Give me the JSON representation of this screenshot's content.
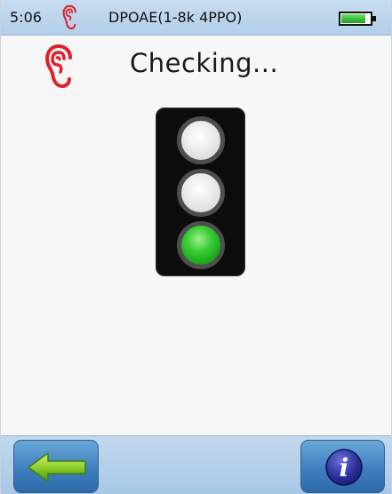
{
  "status_bar": {
    "time": "5:06",
    "ear_icon": "ear-icon",
    "protocol": "DPOAE(1-8k 4PPO)",
    "battery_level": 0.85,
    "battery_color": "#1aa31a"
  },
  "header": {
    "ear_icon": "ear-icon",
    "ear_color": "#e0202a",
    "title": "Checking..."
  },
  "traffic_light": {
    "lamps": [
      "off",
      "off",
      "on"
    ],
    "active_color": "#3fcf3b"
  },
  "bottom_bar": {
    "back_icon": "back-arrow-icon",
    "info_icon": "info-icon",
    "info_glyph": "i"
  }
}
